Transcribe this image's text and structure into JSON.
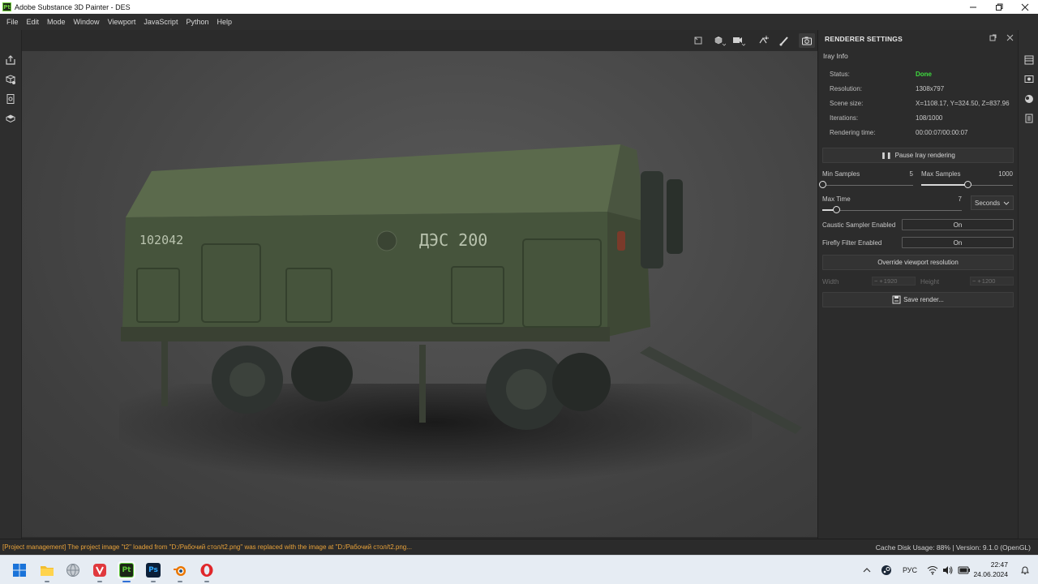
{
  "window": {
    "title": "Adobe Substance 3D Painter - DES",
    "app_icon_text": "Pt",
    "controls": [
      "minimize-icon",
      "maximize-icon",
      "close-icon"
    ]
  },
  "menu": [
    "File",
    "Edit",
    "Mode",
    "Window",
    "Viewport",
    "JavaScript",
    "Python",
    "Help"
  ],
  "left_toolbar": [
    "export-icon",
    "bake-icon",
    "document-icon",
    "shelf-icon"
  ],
  "viewport_toolbar": [
    "frame-icon",
    "cube-icon",
    "camera-icon",
    "lights-icon",
    "brush-icon",
    "render-camera-icon"
  ],
  "viewport": {
    "trailer_text_left": "102042",
    "trailer_text_right": "ДЭС 200"
  },
  "renderer": {
    "panel_title": "RENDERER SETTINGS",
    "section": "Iray Info",
    "rows": {
      "status_label": "Status:",
      "status_value": "Done",
      "resolution_label": "Resolution:",
      "resolution_value": "1308x797",
      "scene_label": "Scene size:",
      "scene_value": "X=1108.17, Y=324.50, Z=837.96",
      "iterations_label": "Iterations:",
      "iterations_value": "108/1000",
      "time_label": "Rendering time:",
      "time_value": "00:00:07/00:00:07"
    },
    "pause_button": "Pause Iray rendering",
    "min_samples_label": "Min Samples",
    "min_samples_value": "5",
    "min_samples_fraction": 0.0,
    "max_samples_label": "Max Samples",
    "max_samples_value": "1000",
    "max_samples_fraction": 0.5,
    "max_time_label": "Max Time",
    "max_time_value": "7",
    "max_time_fraction": 0.1,
    "max_time_unit": "Seconds",
    "caustic_label": "Caustic Sampler Enabled",
    "caustic_value": "On",
    "firefly_label": "Firefly Filter Enabled",
    "firefly_value": "On",
    "override_button": "Override viewport resolution",
    "width_label": "Width",
    "width_value": "1920",
    "height_label": "Height",
    "height_value": "1200",
    "save_button": "Save render..."
  },
  "right_sidebar": [
    "layers-icon",
    "display-icon",
    "environment-icon",
    "log-icon"
  ],
  "status": {
    "message": "[Project management] The project image \"t2\" loaded from \"D:/Рабочий стол/t2.png\" was replaced with the image at \"D:/Рабочий стол/t2.png...",
    "right": "Cache Disk Usage:   88% | Version: 9.1.0 (OpenGL)"
  },
  "taskbar": {
    "apps": [
      "windows-start-icon",
      "file-explorer-icon",
      "globe-app-icon",
      "vivaldi-icon",
      "substance-painter-icon",
      "photoshop-icon",
      "blender-icon",
      "opera-icon"
    ],
    "ps_text": "Ps",
    "pt_text": "Pt",
    "lang": "РУС",
    "time": "22:47",
    "date": "24.06.2024"
  },
  "colors": {
    "status_done": "#3fdc3f",
    "status_message": "#e8a23a",
    "trailer_green": "#4a5a40"
  }
}
